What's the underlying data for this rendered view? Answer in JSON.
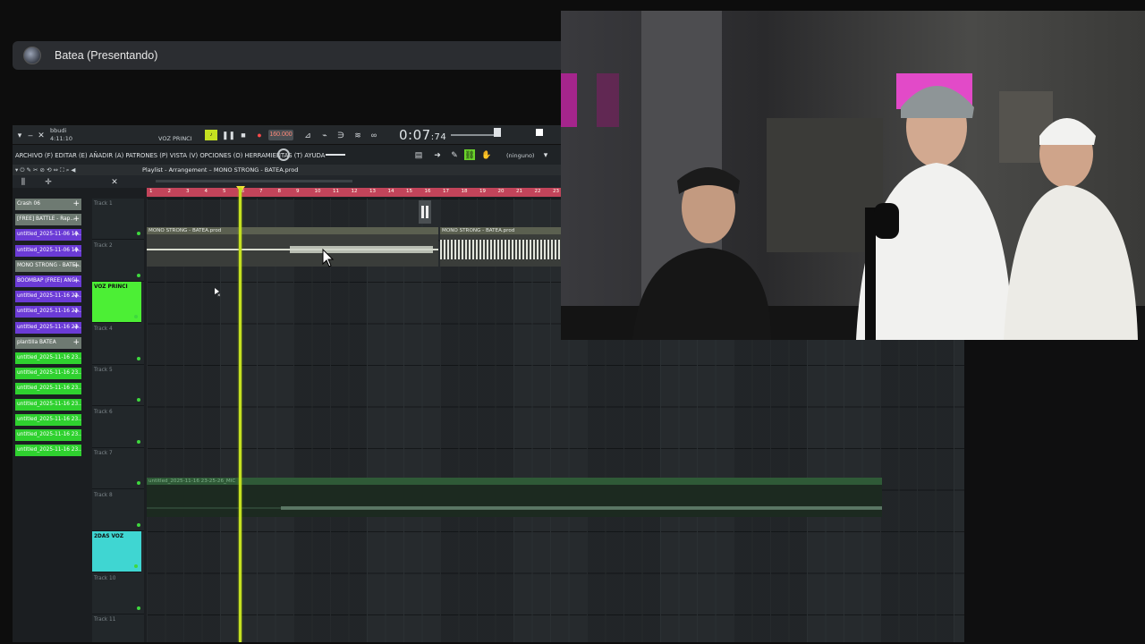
{
  "presenting": {
    "title": "Batea (Presentando)"
  },
  "daw": {
    "top": {
      "user": "bbudi",
      "clock": "4:11:10",
      "pattern_name": "VOZ PRINCI",
      "bpm": "160.000",
      "time": "0:07",
      "time_sub": ":74",
      "snap": "(ninguno)"
    },
    "menu": "ARCHIVO (F) EDITAR (E) AÑADIR (A) PATRONES (P) VISTA (V) OPCIONES (O) HERRAMIENTAS (T) AYUDA",
    "playlist_title": "Playlist - Arrangement – MONO STRONG - BATEA.prod",
    "ruler": [
      "1",
      "2",
      "3",
      "4",
      "5",
      "6",
      "7",
      "8",
      "9",
      "10",
      "11",
      "12",
      "13",
      "14",
      "15",
      "16",
      "17",
      "18",
      "19",
      "20",
      "21",
      "22",
      "23"
    ],
    "patterns": [
      {
        "label": "Crash 06",
        "color": "gray",
        "plus": true
      },
      {
        "label": "[FREE] BATTLE - Rap...",
        "color": "gray",
        "plus": true
      },
      {
        "label": "untitled_2025-11-06 19...",
        "color": "purple",
        "plus": true
      },
      {
        "label": "untitled_2025-11-06 19...",
        "color": "purple",
        "plus": true
      },
      {
        "label": "MONO STRONG - BATE...",
        "color": "gray",
        "plus": true
      },
      {
        "label": "BOOMBAP (FREE) ANG...",
        "color": "purple",
        "plus": true
      },
      {
        "label": "untitled_2025-11-16 22...",
        "color": "purple",
        "plus": true
      },
      {
        "label": "untitled_2025-11-16 22...",
        "color": "purple",
        "plus": true
      },
      {
        "label": "untitled_2025-11-16 23...",
        "color": "purple",
        "plus": true
      },
      {
        "label": "plantilla BATEA",
        "color": "gray",
        "plus": true
      },
      {
        "label": "untitled_2025-11-16 23...",
        "color": "green",
        "plus": false
      },
      {
        "label": "untitled_2025-11-16 23...",
        "color": "green",
        "plus": false
      },
      {
        "label": "untitled_2025-11-16 23...",
        "color": "green",
        "plus": false
      },
      {
        "label": "untitled_2025-11-16 23...",
        "color": "green",
        "plus": false
      },
      {
        "label": "untitled_2025-11-16 23...",
        "color": "green",
        "plus": false
      },
      {
        "label": "untitled_2025-11-16 23...",
        "color": "green",
        "plus": false
      },
      {
        "label": "untitled_2025-11-16 23...",
        "color": "green",
        "plus": false
      }
    ],
    "tracks": [
      {
        "label": "Track 1"
      },
      {
        "label": "Track 2"
      },
      {
        "label": "VOZ PRINCI",
        "color": "#4cef35"
      },
      {
        "label": "Track 4"
      },
      {
        "label": "Track 5"
      },
      {
        "label": "Track 6"
      },
      {
        "label": "Track 7"
      },
      {
        "label": "Track 8"
      },
      {
        "label": "2DAS VOZ",
        "color": "#3fd6d2"
      },
      {
        "label": "Track 10"
      },
      {
        "label": "Track 11"
      }
    ],
    "clips": {
      "mono_a": "MONO STRONG - BATEA.prod",
      "mono_b": "MONO STRONG - BATEA.prod",
      "vox": "untitled_2025-11-16 23-25-26_MIC"
    }
  },
  "colors": {
    "accent_green": "#4cef35",
    "accent_cyan": "#3fd6d2",
    "playhead": "#c4e021",
    "ruler": "#c2445a"
  }
}
